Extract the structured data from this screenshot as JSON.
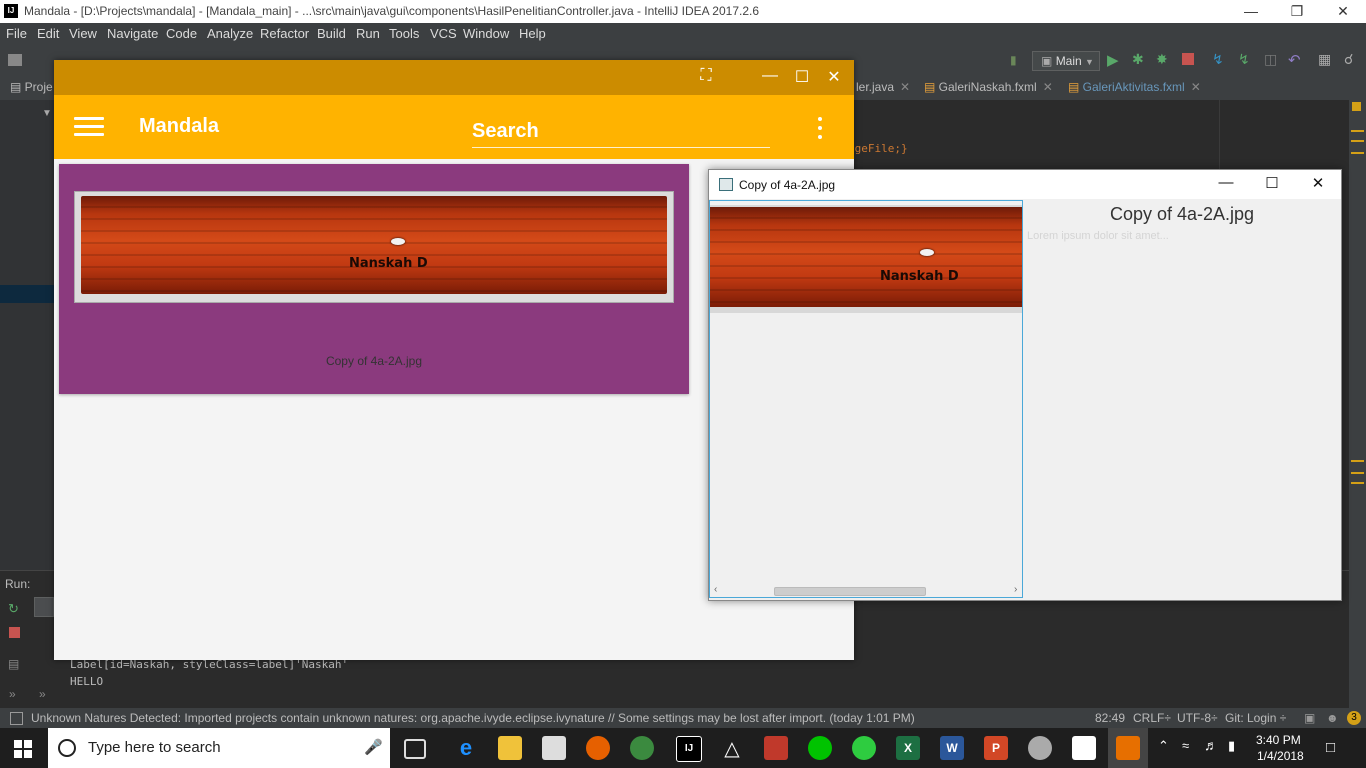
{
  "ide": {
    "logo_text": "IJ",
    "title": "Mandala - [D:\\Projects\\mandala] - [Mandala_main] - ...\\src\\main\\java\\gui\\components\\HasilPenelitianController.java - IntelliJ IDEA 2017.2.6",
    "menu": [
      "File",
      "Edit",
      "View",
      "Navigate",
      "Code",
      "Analyze",
      "Refactor",
      "Build",
      "Run",
      "Tools",
      "VCS",
      "Window",
      "Help"
    ],
    "run_config": "Main",
    "tabs": [
      "ler.java",
      "GaleriNaskah.fxml",
      "GaleriAktivitas.fxml"
    ],
    "left_tab": "Proje",
    "code_snippet": "ageFile;}",
    "run_label": "Run:",
    "console": [
      "Label[id=Naskah, styleClass=label]'Naskah'",
      "HELLO"
    ],
    "status_message": "Unknown Natures Detected: Imported projects contain unknown natures: org.apache.ivyde.eclipse.ivynature // Some settings may be lost after import. (today 1:01 PM)",
    "status_position": "82:49",
    "status_crlf": "CRLF÷",
    "status_encoding": "UTF-8÷",
    "status_git": "Git: Login ÷"
  },
  "mandala": {
    "app_title": "Mandala",
    "search_placeholder": "Search",
    "card_caption": "Copy of 4a-2A.jpg",
    "manuscript_text": "Nanskah D"
  },
  "dialog": {
    "title": "Copy of 4a-2A.jpg",
    "heading": "Copy of 4a-2A.jpg",
    "description": "Lorem ipsum dolor sit amet...",
    "manuscript_text": "Nanskah D"
  },
  "taskbar": {
    "search_placeholder": "Type here to search",
    "time": "3:40 PM",
    "date": "1/4/2018"
  },
  "colors": {
    "appbar": "#ffb300",
    "titlebar": "#cc8c00",
    "card": "#8b3a7e"
  }
}
